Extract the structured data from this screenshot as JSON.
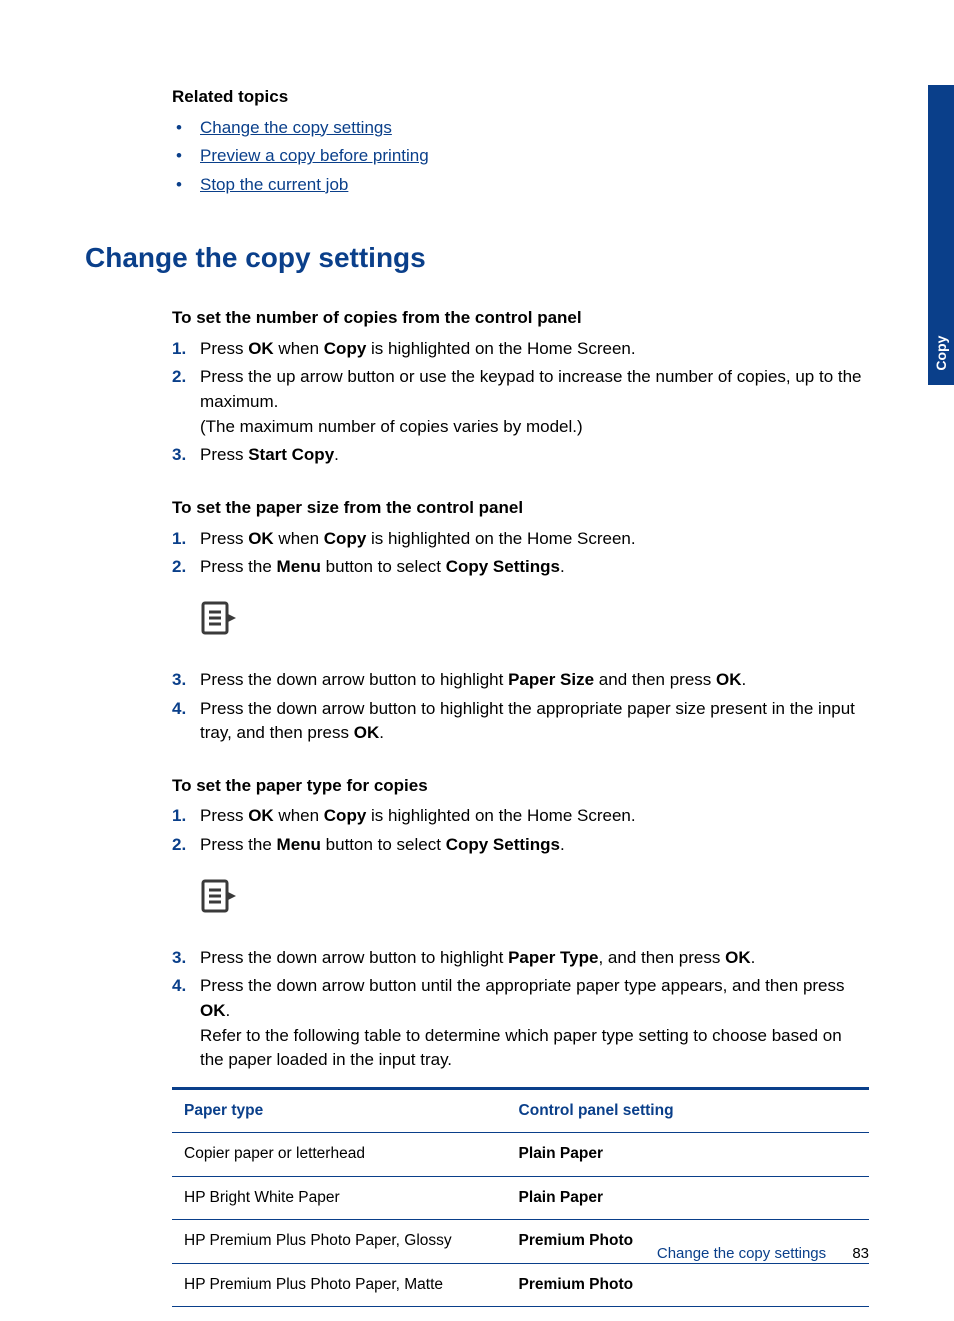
{
  "sideTab": "Copy",
  "related": {
    "heading": "Related topics",
    "links": {
      "l1": "Change the copy settings",
      "l2": "Preview a copy before printing",
      "l3": "Stop the current job"
    }
  },
  "title": "Change the copy settings",
  "sec1": {
    "heading": "To set the number of copies from the control panel",
    "step1a": "Press ",
    "step1b": "OK",
    "step1c": " when ",
    "step1d": "Copy",
    "step1e": " is highlighted on the Home Screen.",
    "step2a": "Press the up arrow button or use the keypad to increase the number of copies, up to the maximum.",
    "step2b": "(The maximum number of copies varies by model.)",
    "step3a": "Press ",
    "step3b": "Start Copy",
    "step3c": "."
  },
  "sec2": {
    "heading": "To set the paper size from the control panel",
    "step1a": "Press ",
    "step1b": "OK",
    "step1c": " when ",
    "step1d": "Copy",
    "step1e": " is highlighted on the Home Screen.",
    "step2a": "Press the ",
    "step2b": "Menu",
    "step2c": " button to select ",
    "step2d": "Copy Settings",
    "step2e": ".",
    "step3a": "Press the down arrow button to highlight ",
    "step3b": "Paper Size",
    "step3c": " and then press ",
    "step3d": "OK",
    "step3e": ".",
    "step4a": "Press the down arrow button to highlight the appropriate paper size present in the input tray, and then press ",
    "step4b": "OK",
    "step4c": "."
  },
  "sec3": {
    "heading": "To set the paper type for copies",
    "step1a": "Press ",
    "step1b": "OK",
    "step1c": " when ",
    "step1d": "Copy",
    "step1e": " is highlighted on the Home Screen.",
    "step2a": "Press the ",
    "step2b": "Menu",
    "step2c": " button to select ",
    "step2d": "Copy Settings",
    "step2e": ".",
    "step3a": "Press the down arrow button to highlight ",
    "step3b": "Paper Type",
    "step3c": ", and then press ",
    "step3d": "OK",
    "step3e": ".",
    "step4a": "Press the down arrow button until the appropriate paper type appears, and then press ",
    "step4b": "OK",
    "step4c": ".",
    "step4d": "Refer to the following table to determine which paper type setting to choose based on the paper loaded in the input tray."
  },
  "table": {
    "h1": "Paper type",
    "h2": "Control panel setting",
    "rows": [
      {
        "type": "Copier paper or letterhead",
        "setting": "Plain Paper"
      },
      {
        "type": "HP Bright White Paper",
        "setting": "Plain Paper"
      },
      {
        "type": "HP Premium Plus Photo Paper, Glossy",
        "setting": "Premium Photo"
      },
      {
        "type": "HP Premium Plus Photo Paper, Matte",
        "setting": "Premium Photo"
      }
    ]
  },
  "footer": {
    "text": "Change the copy settings",
    "page": "83"
  }
}
